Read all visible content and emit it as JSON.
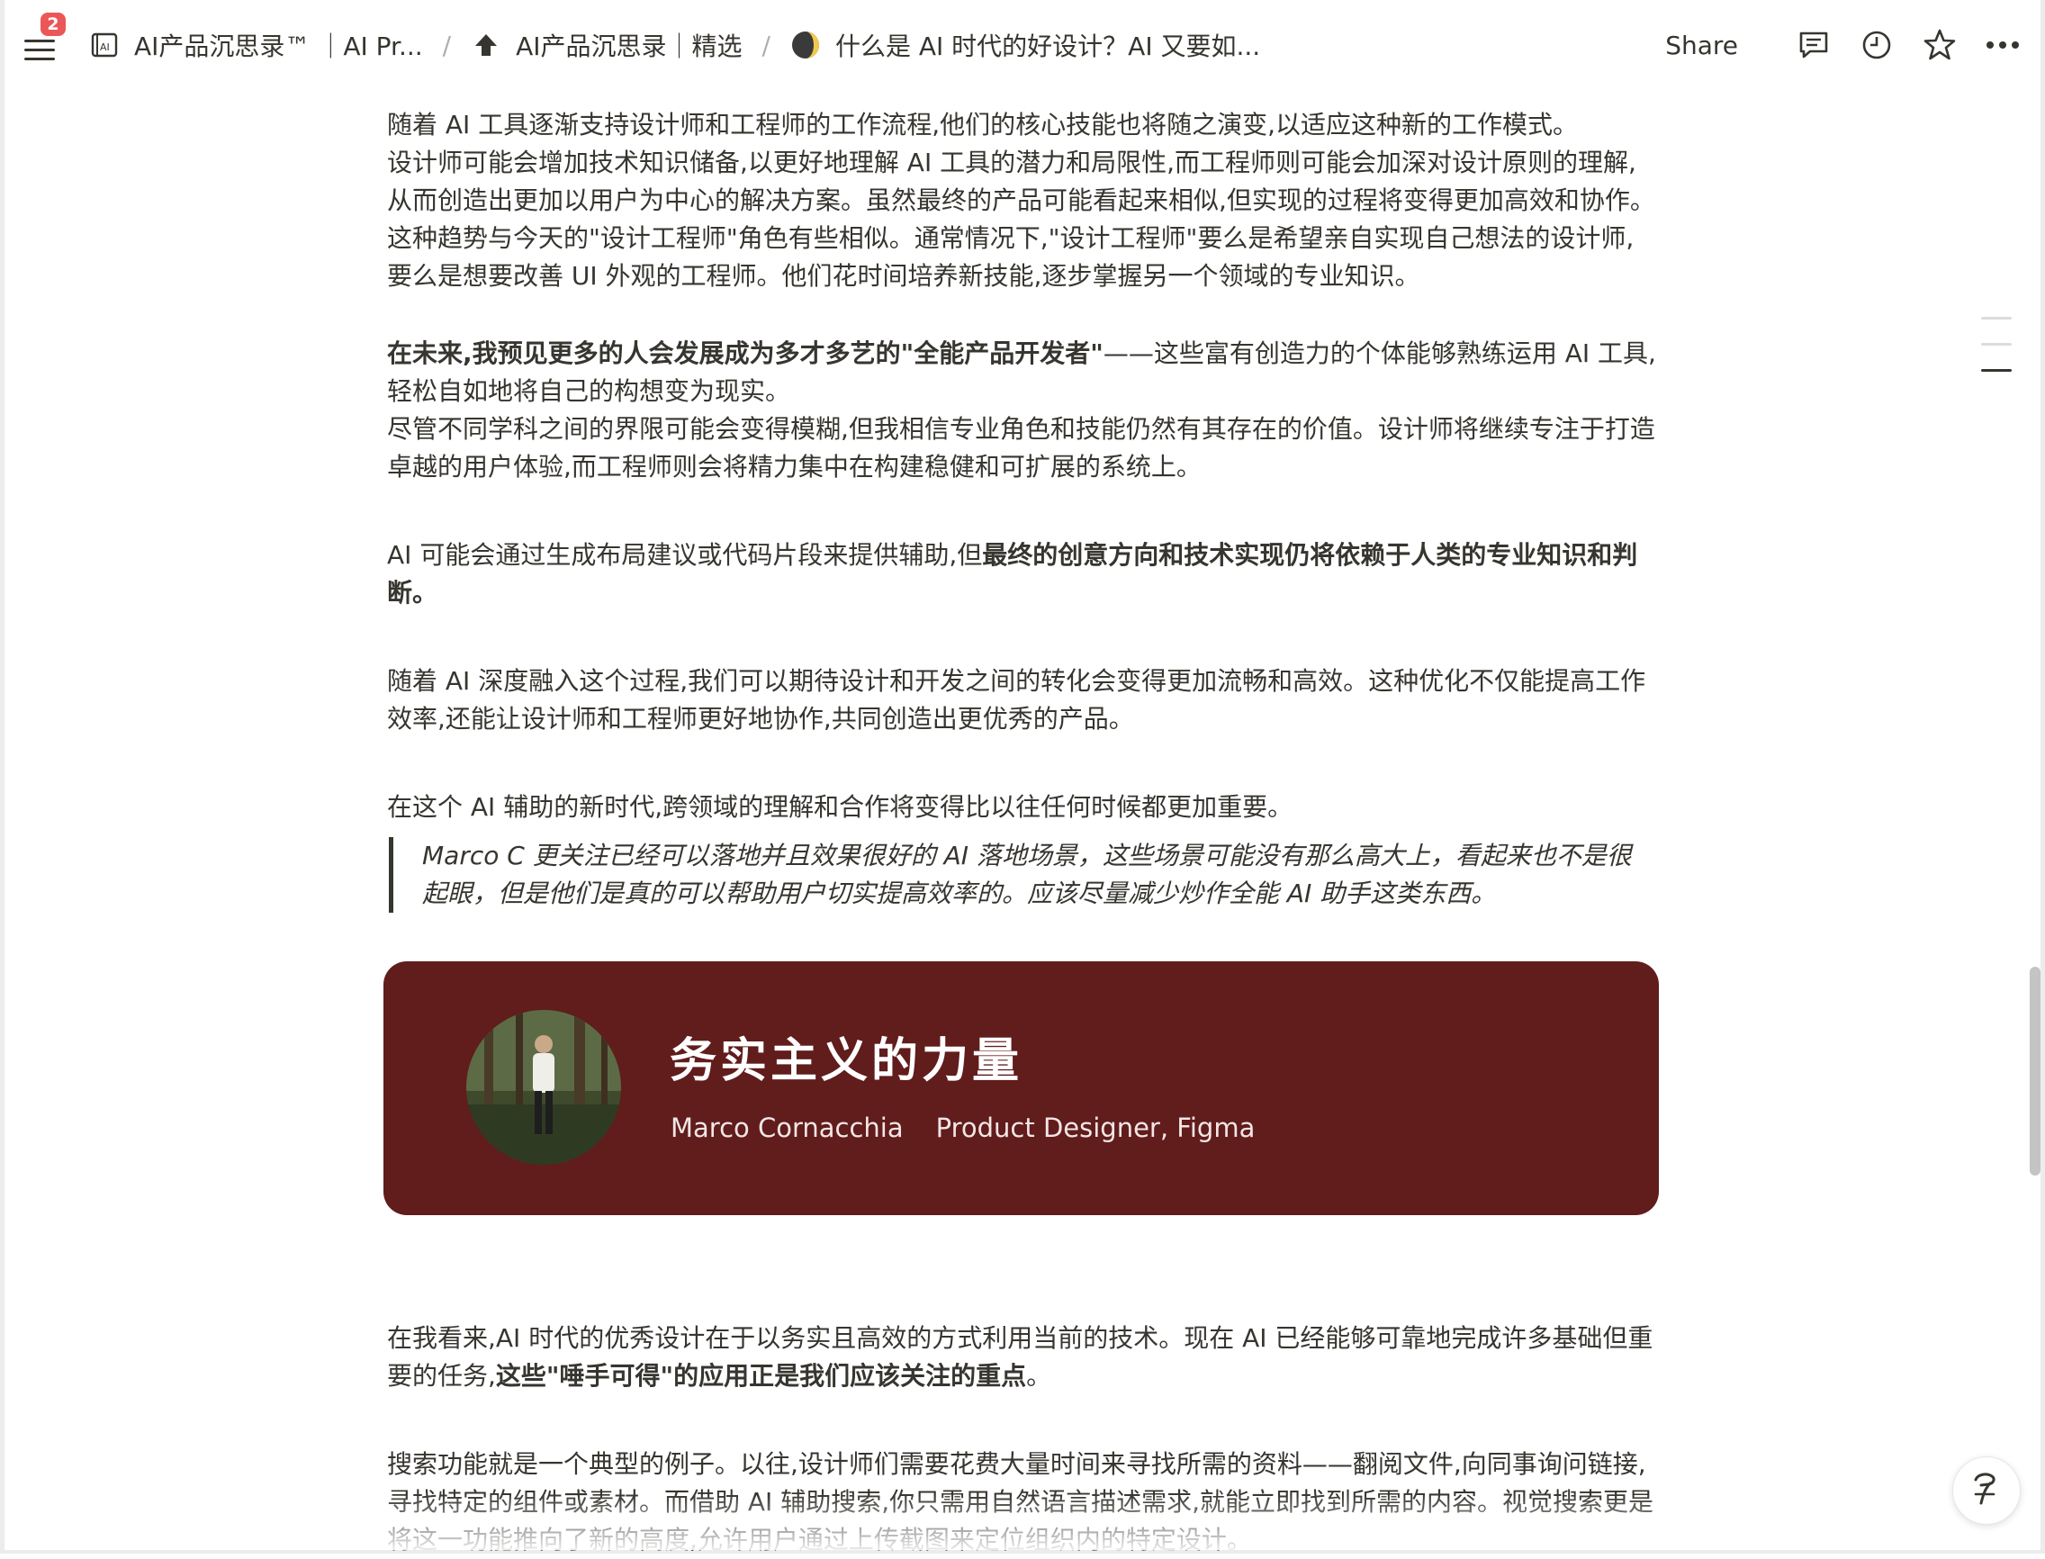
{
  "notifications": {
    "count": "2"
  },
  "breadcrumb": {
    "workspace": "AI产品沉思录™ ｜AI Pr...",
    "parent": "AI产品沉思录｜精选",
    "page": "什么是 AI 时代的好设计？AI 又要如...",
    "separator": "/"
  },
  "toolbar": {
    "share_label": "Share",
    "icons": [
      "comment-icon",
      "clock-icon",
      "star-icon",
      "more-icon"
    ]
  },
  "content": {
    "p1": [
      "随着 AI 工具逐渐支持设计师和工程师的工作流程,他们的核心技能也将随之演变,以适应这种新的工作模式。",
      "设计师可能会增加技术知识储备,以更好地理解 AI 工具的潜力和局限性,而工程师则可能会加深对设计原则的理解,",
      "从而创造出更加以用户为中心的解决方案。虽然最终的产品可能看起来相似,但实现的过程将变得更加高效和协作。",
      "这种趋势与今天的\"设计工程师\"角色有些相似。通常情况下,\"设计工程师\"要么是希望亲自实现自己想法的设计师,",
      "要么是想要改善 UI 外观的工程师。他们花时间培养新技能,逐步掌握另一个领域的专业知识。"
    ],
    "p2_bold": "在未来,我预见更多的人会发展成为多才多艺的\"全能产品开发者\"",
    "p2_rest": "——这些富有创造力的个体能够熟练运用 AI 工具,",
    "p2_line2": "轻松自如地将自己的构想变为现实。",
    "p2_line3": "尽管不同学科之间的界限可能会变得模糊,但我相信专业角色和技能仍然有其存在的价值。设计师将继续专注于打造",
    "p2_line4": "卓越的用户体验,而工程师则会将精力集中在构建稳健和可扩展的系统上。",
    "p3_plain": "AI 可能会通过生成布局建议或代码片段来提供辅助,但",
    "p3_bold": "最终的创意方向和技术实现仍将依赖于人类的专业知识和判",
    "p3_bold2": "断。",
    "p4_line1": "随着 AI 深度融入这个过程,我们可以期待设计和开发之间的转化会变得更加流畅和高效。这种优化不仅能提高工作",
    "p4_line2": "效率,还能让设计师和工程师更好地协作,共同创造出更优秀的产品。",
    "p5": "在这个 AI 辅助的新时代,跨领域的理解和合作将变得比以往任何时候都更加重要。",
    "quote_line1": "Marco C 更关注已经可以落地并且效果很好的 AI 落地场景，这些场景可能没有那么高大上，看起来也不是很",
    "quote_line2": "起眼，但是他们是真的可以帮助用户切实提高效率的。应该尽量减少炒作全能 AI 助手这类东西。"
  },
  "banner": {
    "title": "务实主义的力量",
    "name": "Marco Cornacchia",
    "role": "Product Designer, Figma",
    "background": "#611c1c"
  },
  "content2": {
    "p6_line1": "在我看来,AI 时代的优秀设计在于以务实且高效的方式利用当前的技术。现在 AI 已经能够可靠地完成许多基础但重",
    "p6_plain": "要的任务,",
    "p6_bold": "这些\"唾手可得\"的应用正是我们应该关注的重点",
    "p6_end": "。",
    "p7_line1": "搜索功能就是一个典型的例子。以往,设计师们需要花费大量时间来寻找所需的资料——翻阅文件,向同事询问链接,",
    "p7_line2": "寻找特定的组件或素材。而借助 AI 辅助搜索,你只需用自然语言描述需求,就能立即找到所需的内容。视觉搜索更是",
    "p7_line3": "将这一功能推向了新的高度,允许用户通过上传截图来定位组织内的特定设计。"
  },
  "help": {
    "glyph": "?"
  }
}
